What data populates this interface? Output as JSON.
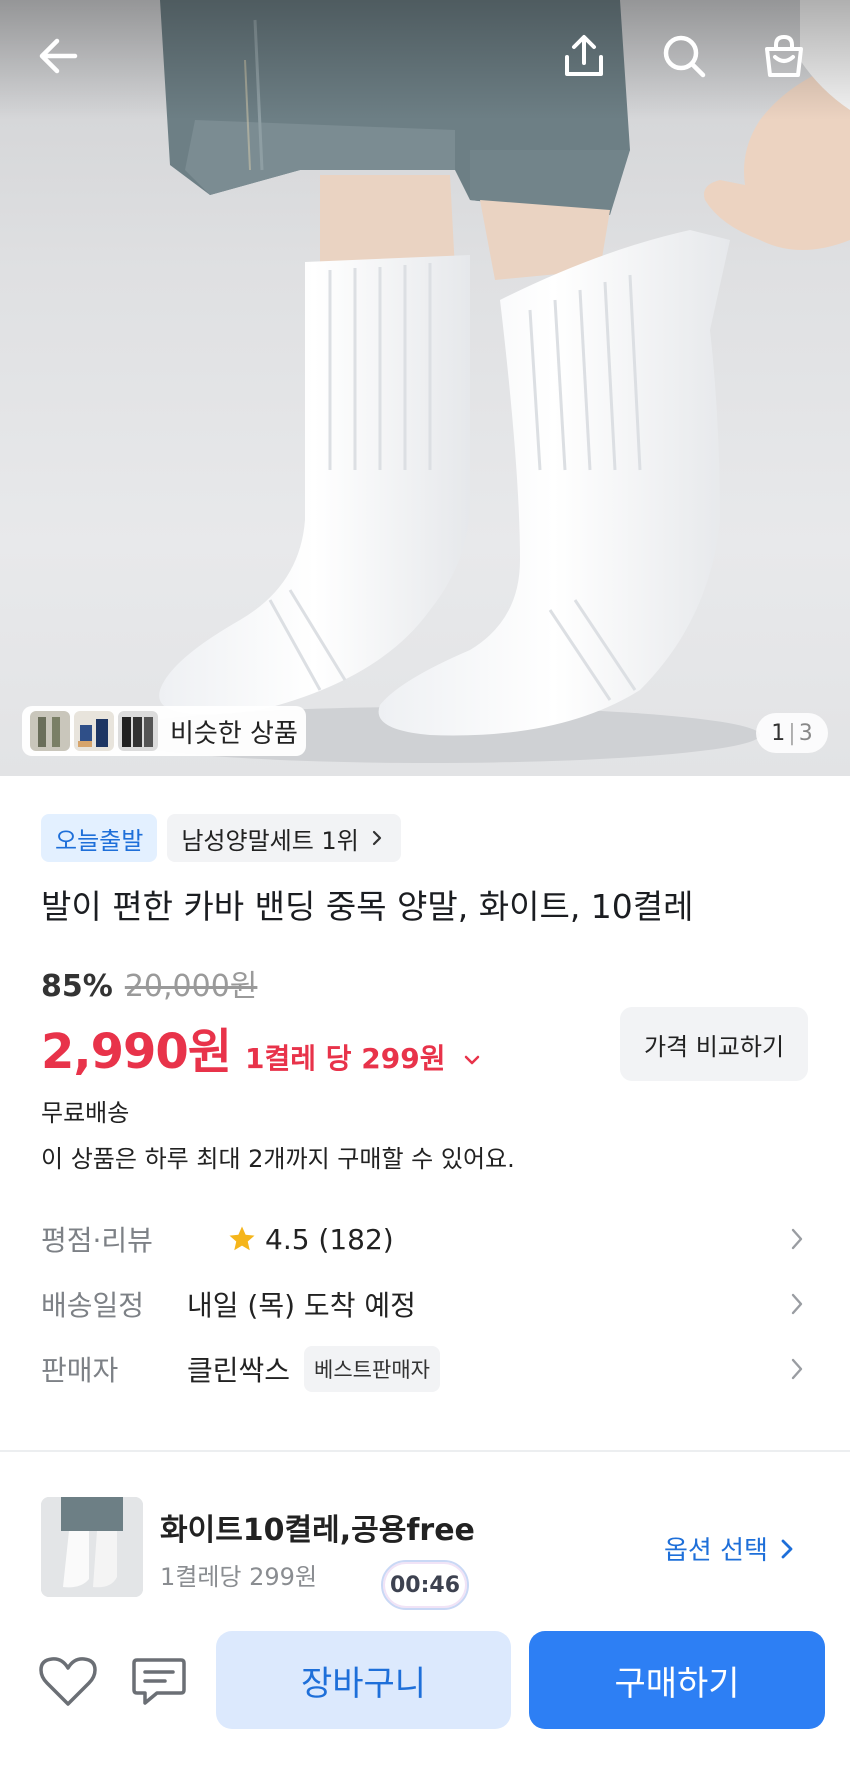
{
  "hero": {
    "icons": [
      "back-arrow-icon",
      "share-icon",
      "search-icon",
      "shopping-bag-icon"
    ],
    "similar_label": "비슷한 상품",
    "image_counter": {
      "current": "1",
      "separator": "|",
      "total": "3"
    }
  },
  "product": {
    "badges": {
      "today_ship": "오늘출발",
      "rank": "남성양말세트 1위"
    },
    "title": "발이 편한 카바 밴딩 중목 양말, 화이트, 10켤레",
    "discount_percent": "85%",
    "original_price": "20,000원",
    "sale_price": "2,990원",
    "unit_price": "1켤레 당 299원",
    "compare_button": "가격 비교하기",
    "free_shipping": "무료배송",
    "purchase_limit": "이 상품은 하루 최대 2개까지 구매할 수 있어요."
  },
  "info": {
    "rating_label": "평점·리뷰",
    "rating_value": "4.5 (182)",
    "delivery_label": "배송일정",
    "delivery_value": "내일 (목) 도착 예정",
    "seller_label": "판매자",
    "seller_value": "클린싹스",
    "seller_badge": "베스트판매자"
  },
  "option": {
    "name": "화이트10켤레,공용free",
    "sub": "1켤레당 299원",
    "timer": "00:46",
    "select_label": "옵션 선택"
  },
  "actions": {
    "cart": "장바구니",
    "buy": "구매하기"
  },
  "colors": {
    "accent": "#2d7ff4",
    "price": "#e8334a",
    "star": "#f5b51b"
  }
}
